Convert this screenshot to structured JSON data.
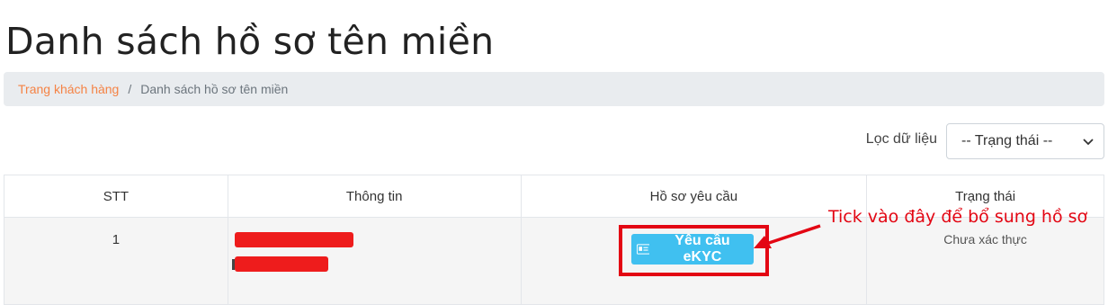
{
  "page": {
    "title": "Danh sách hồ sơ tên miền"
  },
  "breadcrumb": {
    "home": "Trang khách hàng",
    "separator": "/",
    "current": "Danh sách hồ sơ tên miền"
  },
  "filter": {
    "label": "Lọc dữ liệu",
    "select_value": "-- Trạng thái --"
  },
  "table": {
    "headers": [
      "STT",
      "Thông tin",
      "Hồ sơ yêu cầu",
      "Trạng thái"
    ],
    "rows": [
      {
        "stt": "1",
        "request_button": "Yêu cầu eKYC",
        "status": "Chưa xác thực"
      }
    ]
  },
  "annotation": {
    "text": "Tick vào đây để bổ sung hồ sơ",
    "color": "#e30613"
  },
  "colors": {
    "accent_link": "#f58345",
    "button": "#40c0f0",
    "redaction": "#ee1c1c"
  }
}
